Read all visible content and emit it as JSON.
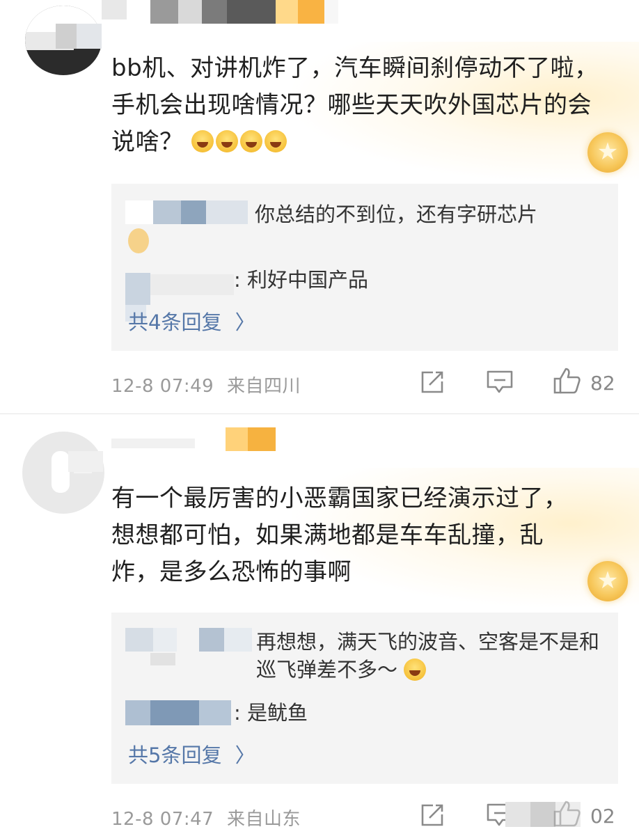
{
  "comments": [
    {
      "text": "bb机、对讲机炸了，汽车瞬间刹停动不了啦，手机会出现啥情况？哪些天天吹外国芯片的会说啥？",
      "emojis": [
        "laugh-cry",
        "laugh-cry",
        "crying",
        "crying"
      ],
      "replies": [
        {
          "text": "你总结的不到位，还有字研芯片"
        },
        {
          "text": ": 利好中国产品"
        }
      ],
      "more_replies": "共4条回复",
      "time": "12-8 07:49",
      "location": "来自四川",
      "likes": "82"
    },
    {
      "text": "有一个最厉害的小恶霸国家已经演示过了，想想都可怕，如果满地都是车车乱撞，乱炸，是多么恐怖的事啊",
      "replies": [
        {
          "text": "再想想，满天飞的波音、空客是不是和巡飞弹差不多～"
        },
        {
          "text": ": 是鱿鱼"
        }
      ],
      "more_replies": "共5条回复",
      "time": "12-8 07:47",
      "location": "来自山东",
      "likes": "02"
    }
  ],
  "colors": {
    "link": "#5577a8",
    "meta": "#9a9a9a",
    "reply_bg": "#f4f4f4",
    "badge": "#f7c75a"
  },
  "icons": [
    "share-icon",
    "comment-icon",
    "like-icon",
    "badge-icon",
    "emoji-icon"
  ]
}
